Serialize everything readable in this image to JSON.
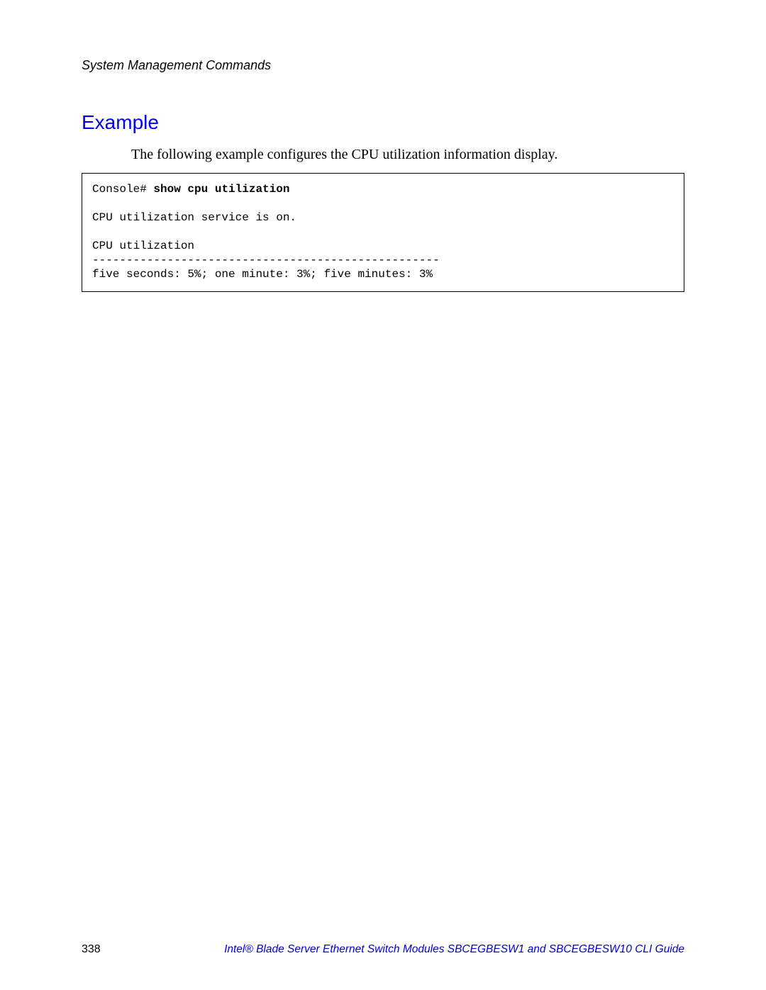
{
  "header": {
    "running": "System Management Commands"
  },
  "section": {
    "heading": "Example",
    "intro": "The following example configures the CPU utilization information display."
  },
  "code": {
    "prompt": "Console# ",
    "command": "show cpu utilization",
    "line_blank1": "",
    "line_service": "CPU utilization service is on.",
    "line_blank2": "",
    "line_title": "CPU utilization",
    "line_sep": "---------------------------------------------------",
    "line_stats": "five seconds: 5%; one minute: 3%; five minutes: 3%"
  },
  "footer": {
    "page_number": "338",
    "title": "Intel® Blade Server Ethernet Switch Modules SBCEGBESW1 and SBCEGBESW10 CLI Guide"
  }
}
